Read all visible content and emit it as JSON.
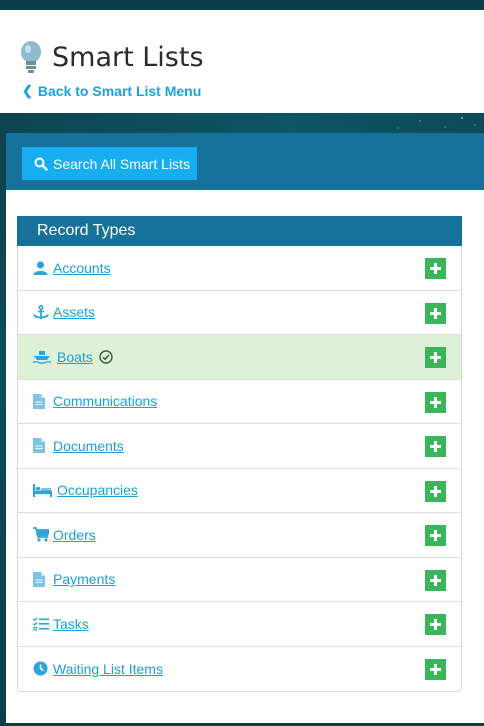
{
  "header": {
    "title": "Smart Lists",
    "back_link": "Back to Smart List Menu"
  },
  "search_button": {
    "label": "Search All Smart Lists"
  },
  "record_types": {
    "heading": "Record Types",
    "items": [
      {
        "label": "Accounts",
        "icon": "user-icon",
        "selected": false
      },
      {
        "label": "Assets",
        "icon": "anchor-icon",
        "selected": false
      },
      {
        "label": "Boats",
        "icon": "boat-icon",
        "selected": true
      },
      {
        "label": "Communications",
        "icon": "document-icon",
        "selected": false
      },
      {
        "label": "Documents",
        "icon": "document-icon",
        "selected": false
      },
      {
        "label": "Occupancies",
        "icon": "bed-icon",
        "selected": false
      },
      {
        "label": "Orders",
        "icon": "cart-icon",
        "selected": false
      },
      {
        "label": "Payments",
        "icon": "document-icon",
        "selected": false
      },
      {
        "label": "Tasks",
        "icon": "tasks-icon",
        "selected": false
      },
      {
        "label": "Waiting List Items",
        "icon": "clock-icon",
        "selected": false
      }
    ]
  },
  "colors": {
    "accent": "#1ba3dd",
    "header_band": "#16729a",
    "search_button": "#16aef0",
    "add_button": "#3bb55a",
    "selected_row": "#dff0d8"
  }
}
